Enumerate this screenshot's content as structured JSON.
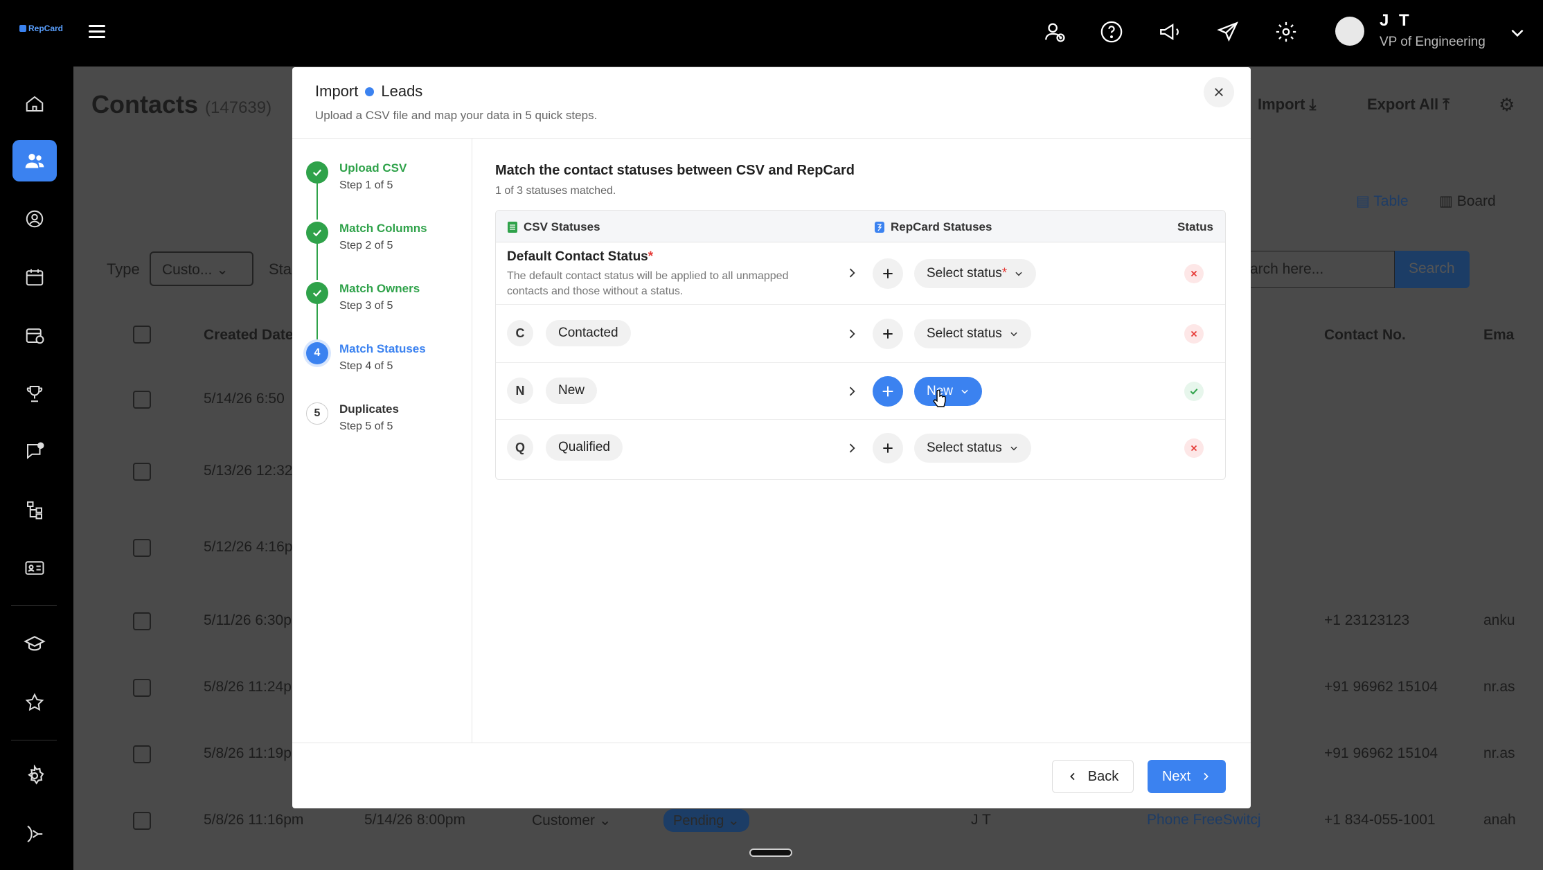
{
  "app": {
    "logo_text": "RepCard"
  },
  "user": {
    "name": "J T",
    "role": "VP of Engineering"
  },
  "background_page": {
    "title": "Contacts",
    "count": "(147639)",
    "actions": {
      "import": "Import",
      "export": "Export All"
    },
    "view_toggle": {
      "table": "Table",
      "board": "Board"
    },
    "filter": {
      "type_label": "Type",
      "type_value": "Custo...",
      "status_label_partial": "Sta"
    },
    "search": {
      "placeholder": "arch here...",
      "button": "Search"
    },
    "columns": {
      "created": "Created Date",
      "contact_no": "Contact No.",
      "email": "Ema"
    },
    "rows": [
      {
        "created": "5/14/26 6:50",
        "contact": "",
        "email": ""
      },
      {
        "created": "5/13/26 12:32",
        "contact": "",
        "email": ""
      },
      {
        "created": "5/12/26 4:16p",
        "contact": "",
        "email": ""
      },
      {
        "created": "5/11/26 6:30p",
        "contact": "+1 23123123",
        "email": "anku"
      },
      {
        "created": "5/8/26 11:24p",
        "contact": "+91 96962 15104",
        "email": "nr.as"
      },
      {
        "created": "5/8/26 11:19p",
        "contact": "+91 96962 15104",
        "email": "nr.as"
      },
      {
        "created": "5/8/26 11:16pm",
        "updated": "5/14/26 8:00pm",
        "type": "Customer",
        "status": "Pending",
        "owner": "J T",
        "source": "Phone FreeSwitcj",
        "contact": "+1 834-055-1001",
        "email": "anah"
      }
    ]
  },
  "modal": {
    "title_left": "Import",
    "title_right": "Leads",
    "subtitle": "Upload a CSV file and map your data in 5 quick steps.",
    "steps": [
      {
        "name": "Upload CSV",
        "num": "Step 1 of 5",
        "state": "done",
        "badge": ""
      },
      {
        "name": "Match Columns",
        "num": "Step 2 of 5",
        "state": "done",
        "badge": ""
      },
      {
        "name": "Match Owners",
        "num": "Step 3 of 5",
        "state": "done",
        "badge": ""
      },
      {
        "name": "Match Statuses",
        "num": "Step 4 of 5",
        "state": "current",
        "badge": "4"
      },
      {
        "name": "Duplicates",
        "num": "Step 5 of 5",
        "state": "todo",
        "badge": "5"
      }
    ],
    "content": {
      "heading": "Match the contact statuses between CSV and RepCard",
      "subheading": "1 of 3 statuses matched.",
      "columns": {
        "csv": "CSV Statuses",
        "repcard": "RepCard Statuses",
        "status": "Status"
      },
      "default_row": {
        "label": "Default Contact Status",
        "required_mark": "*",
        "description": "The default contact status will be applied to all unmapped contacts and those without a status.",
        "select_label": "Select status",
        "select_required": "*",
        "matched": false
      },
      "rows": [
        {
          "letter": "C",
          "csv_status": "Contacted",
          "select_label": "Select status",
          "matched": false
        },
        {
          "letter": "N",
          "csv_status": "New",
          "select_label": "New",
          "matched": true
        },
        {
          "letter": "Q",
          "csv_status": "Qualified",
          "select_label": "Select status",
          "matched": false
        }
      ]
    },
    "footer": {
      "back": "Back",
      "next": "Next"
    }
  },
  "colors": {
    "accent": "#3b82f0",
    "success": "#2fa24a",
    "danger": "#e53935"
  }
}
